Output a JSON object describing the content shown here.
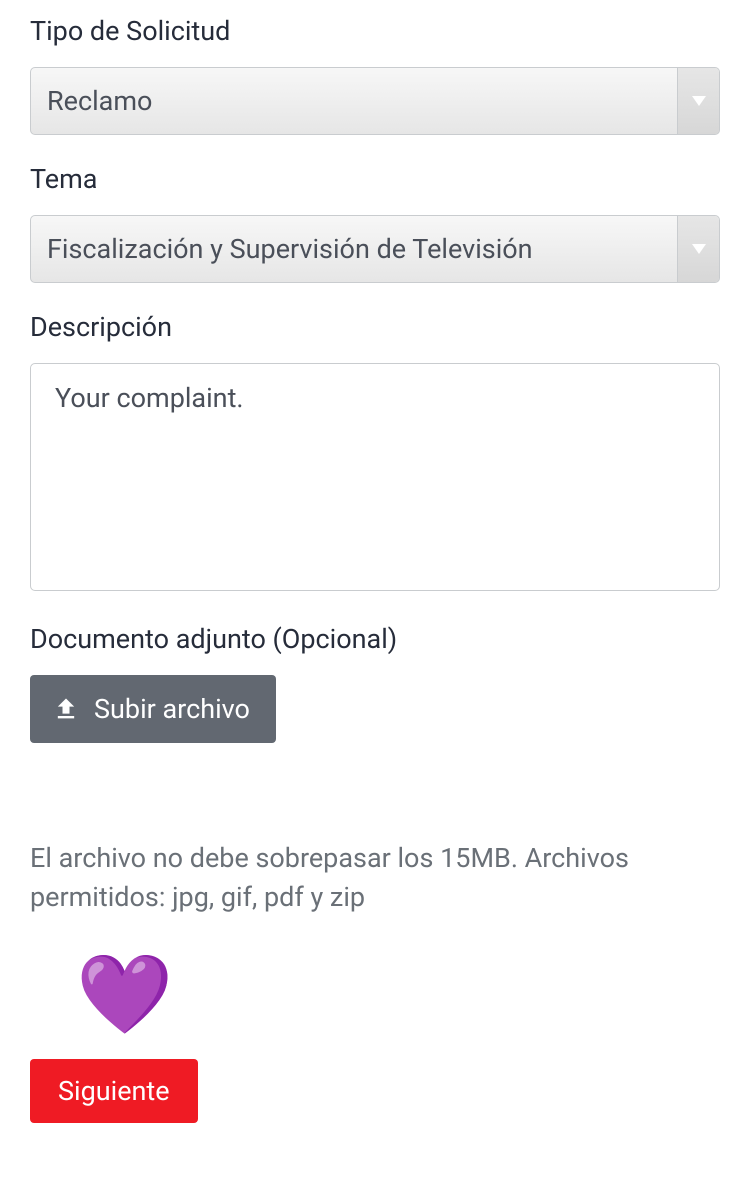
{
  "form": {
    "tipo_solicitud": {
      "label": "Tipo de Solicitud",
      "value": "Reclamo"
    },
    "tema": {
      "label": "Tema",
      "value": "Fiscalización y Supervisión de Televisión"
    },
    "descripcion": {
      "label": "Descripción",
      "value": "Your complaint."
    },
    "documento": {
      "label": "Documento adjunto (Opcional)",
      "upload_label": "Subir archivo",
      "help_text": "El archivo no debe sobrepasar los 15MB. Archivos permitidos: jpg, gif, pdf y zip"
    },
    "heart_icon": "💜",
    "next_button": "Siguiente"
  }
}
